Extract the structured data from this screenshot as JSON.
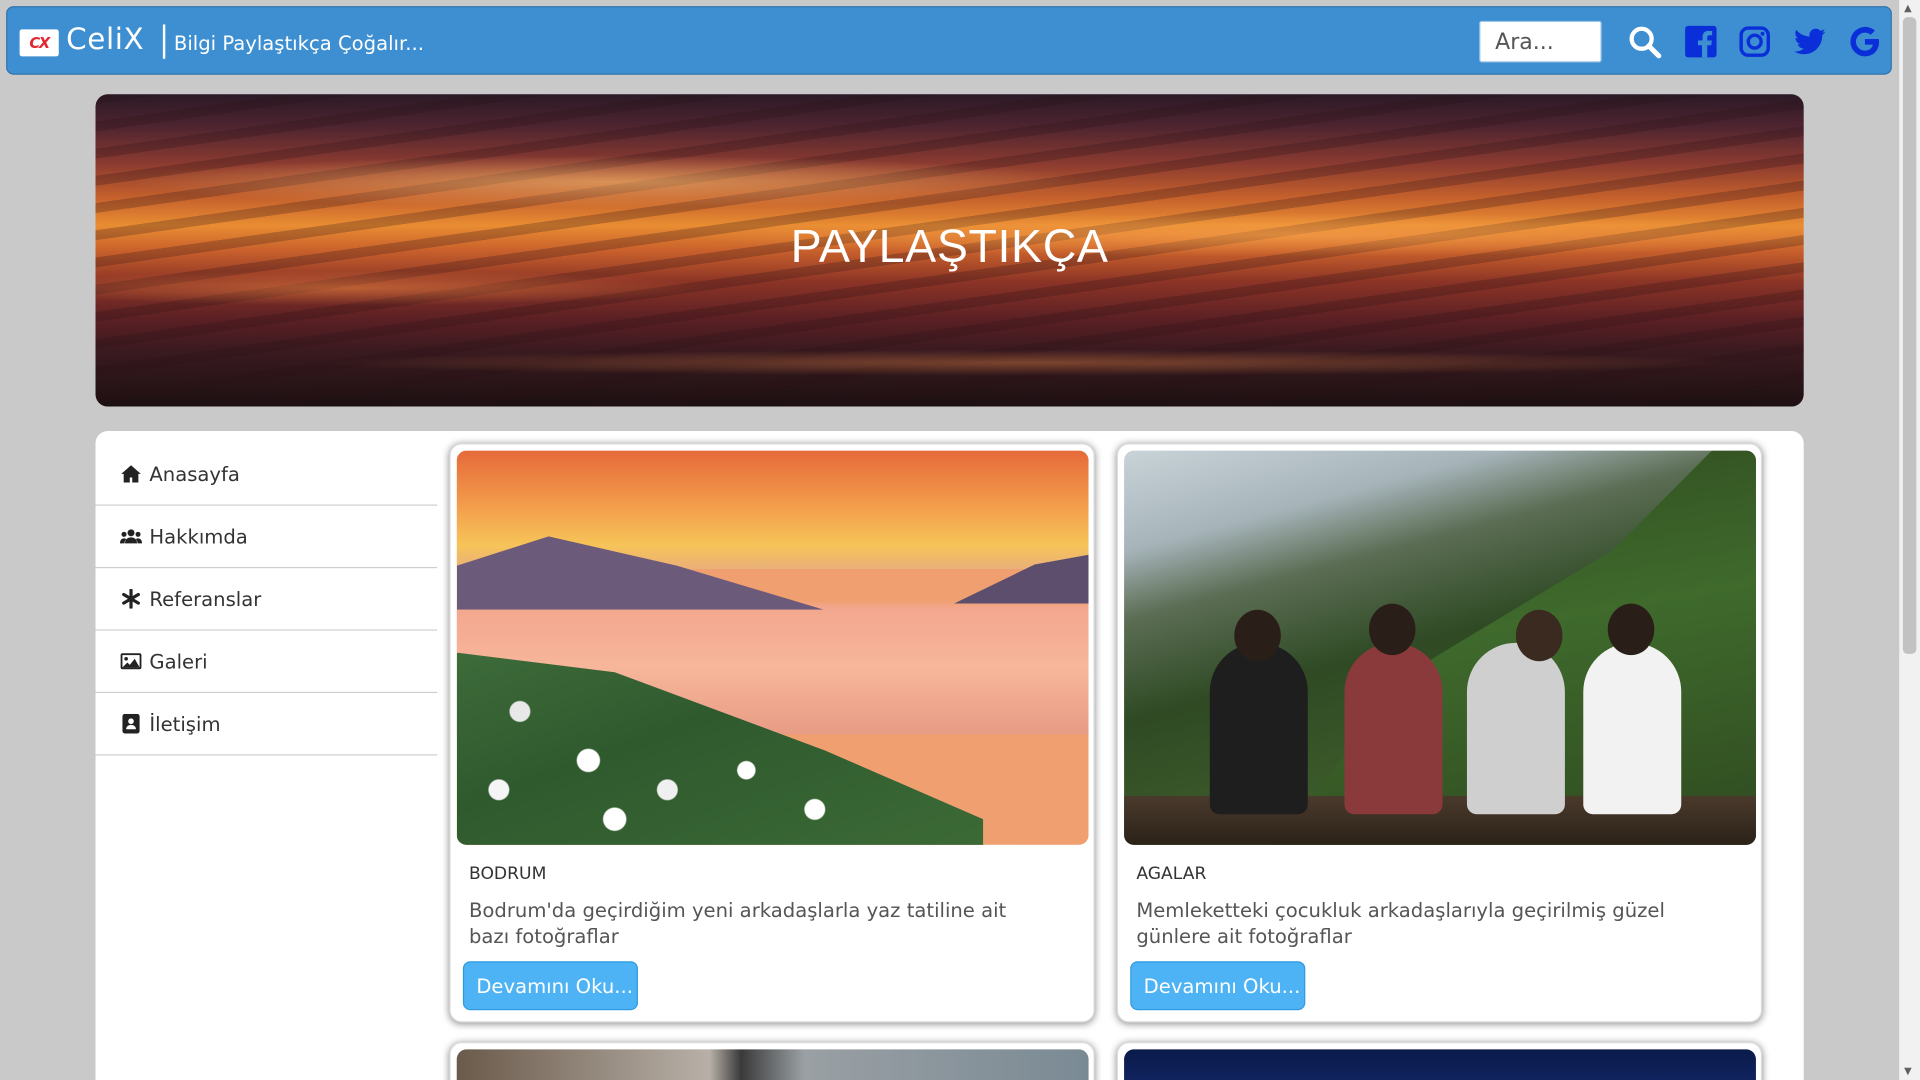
{
  "navbar": {
    "logo_text": "CX",
    "brand": "CeliX",
    "tagline": "Bilgi Paylaştıkça Çoğalır...",
    "search_placeholder": "Ara...",
    "icons": [
      "search-icon",
      "facebook-icon",
      "instagram-icon",
      "twitter-icon",
      "google-icon"
    ],
    "accent_color": "#3d8fd1"
  },
  "hero": {
    "title": "PAYLAŞTIKÇA"
  },
  "sidebar": {
    "items": [
      {
        "label": "Anasayfa",
        "icon": "home-icon"
      },
      {
        "label": "Hakkımda",
        "icon": "users-icon"
      },
      {
        "label": "Referanslar",
        "icon": "asterisk-icon"
      },
      {
        "label": "Galeri",
        "icon": "image-icon"
      },
      {
        "label": "İletişim",
        "icon": "contact-card-icon"
      }
    ]
  },
  "cards": [
    {
      "title": "BODRUM",
      "text": "Bodrum'da geçirdiğim yeni arkadaşlarla yaz tatiline ait bazı fotoğraflar",
      "button": "Devamını Oku..."
    },
    {
      "title": "AGALAR",
      "text": "Memleketteki çocukluk arkadaşlarıyla geçirilmiş güzel günlere ait fotoğraflar",
      "button": "Devamını Oku..."
    }
  ],
  "colors": {
    "button": "#4db3f5",
    "page_bg": "#c9c9c9"
  }
}
